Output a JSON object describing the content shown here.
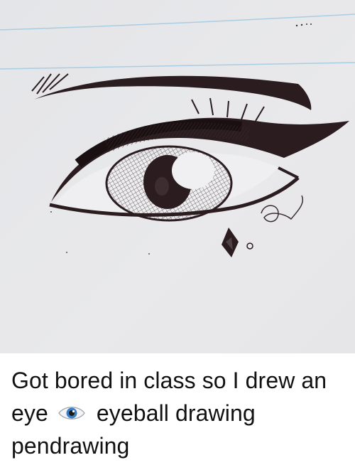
{
  "post": {
    "caption_before_emoji": "Got bored in class so I drew an eye",
    "caption_after_emoji": "eyeball drawing pendrawing",
    "emoji_icon": "eye-icon"
  },
  "drawing": {
    "subject": "pen drawing of an eye on lined notebook paper",
    "ink_color": "#2a1c1f",
    "paper_color": "#e8e8ea",
    "rule_line_color": "#9fc6dc"
  }
}
